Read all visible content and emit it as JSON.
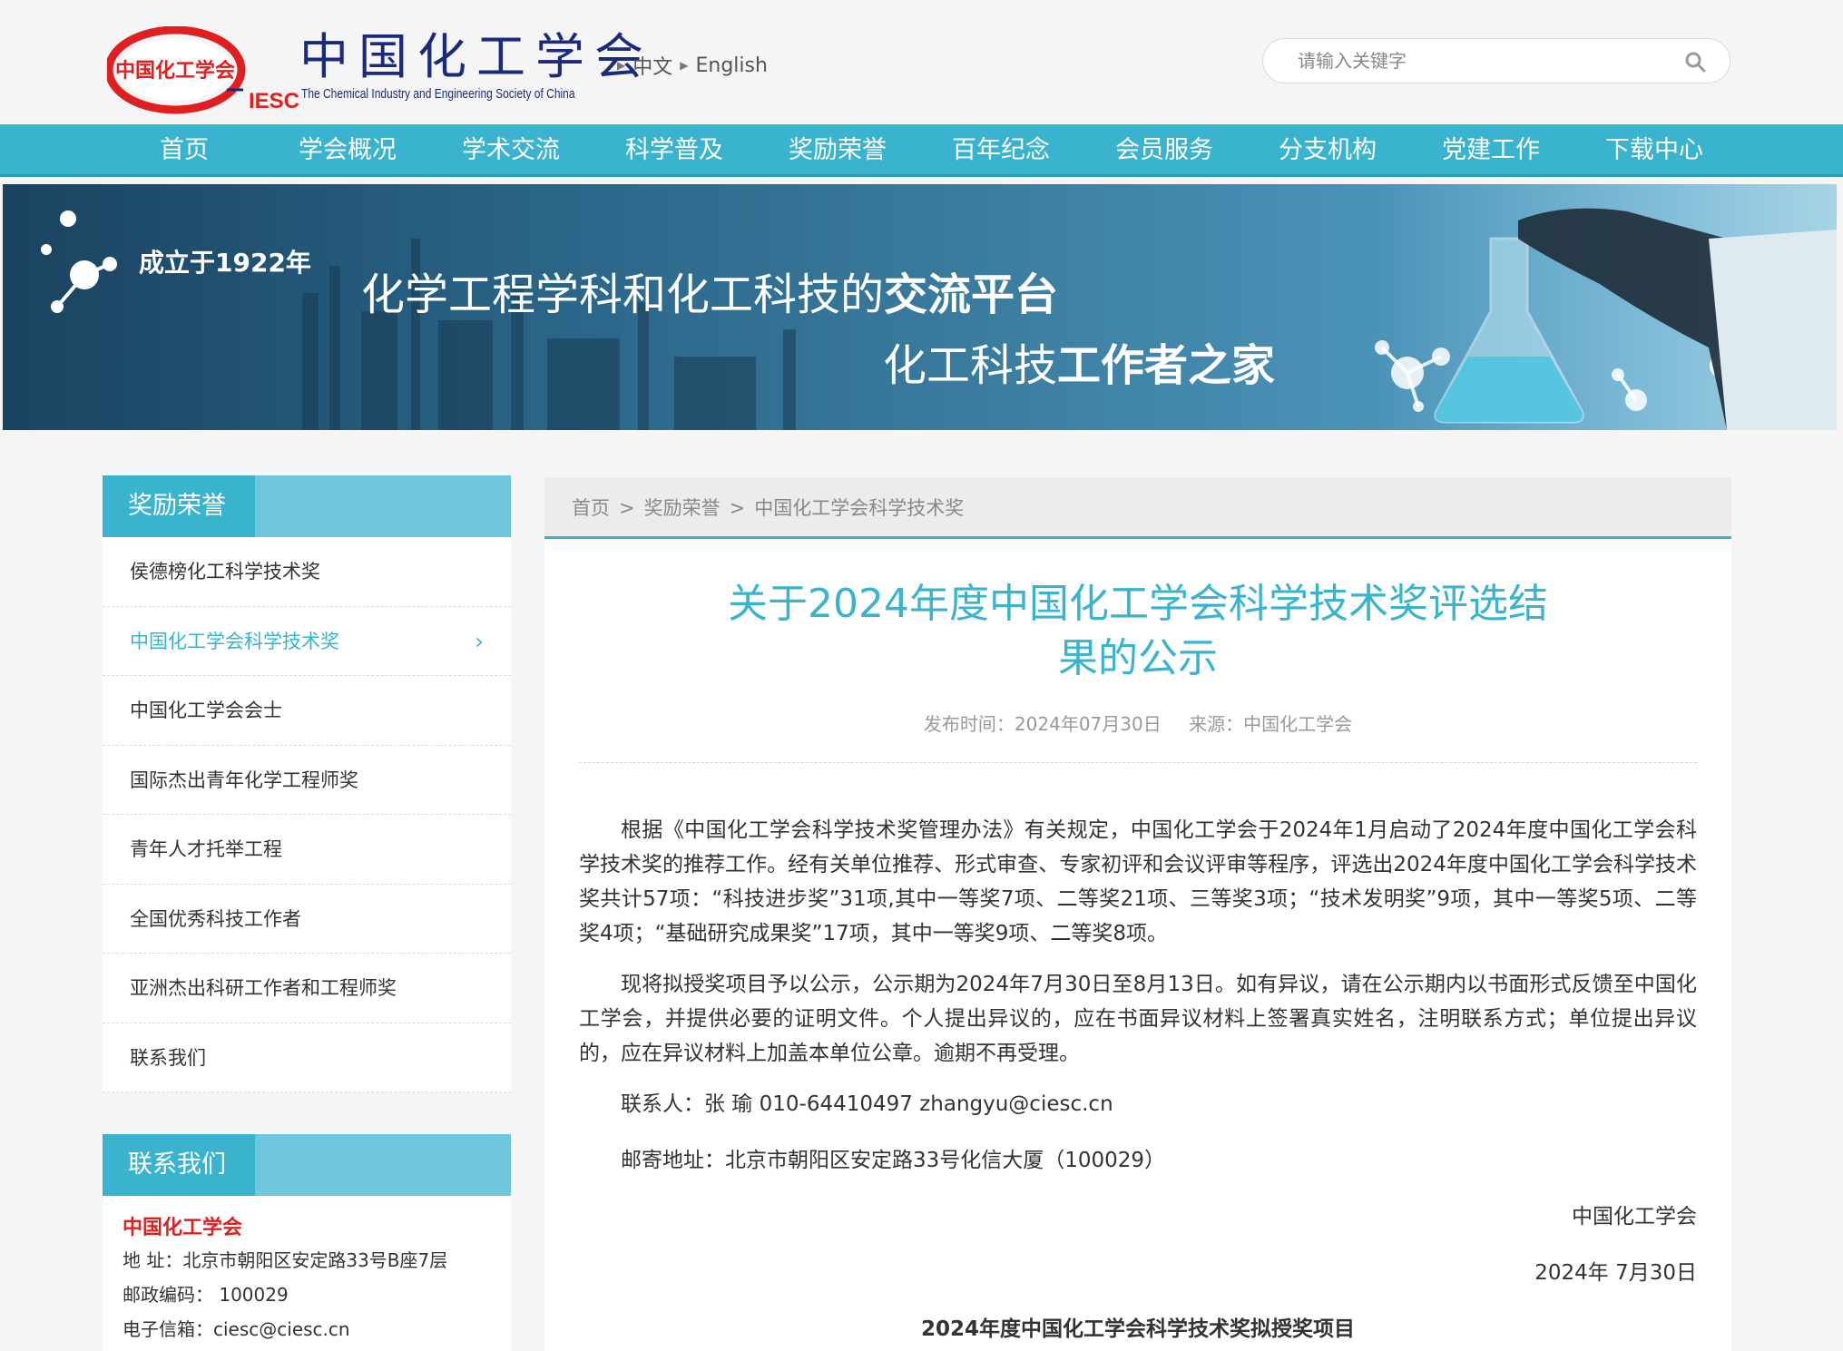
{
  "header": {
    "logo_badge": "中国化工学会",
    "logo_badge_suffix": "IESC",
    "logo_cn": "中国化工学会",
    "logo_en": "The Chemical Industry and Engineering Society of China",
    "lang_cn": "中文",
    "lang_en": "English",
    "search_placeholder": "请输入关键字"
  },
  "nav": [
    "首页",
    "学会概况",
    "学术交流",
    "科学普及",
    "奖励荣誉",
    "百年纪念",
    "会员服务",
    "分支机构",
    "党建工作",
    "下载中心"
  ],
  "banner": {
    "founded": "成立于1922年",
    "line1_normal": "化学工程学科和化工科技的",
    "line1_bold": "交流平台",
    "line2_normal": "化工科技",
    "line2_bold": "工作者之家"
  },
  "sidebar": {
    "title": "奖励荣誉",
    "items": [
      "侯德榜化工科学技术奖",
      "中国化工学会科学技术奖",
      "中国化工学会会士",
      "国际杰出青年化学工程师奖",
      "青年人才托举工程",
      "全国优秀科技工作者",
      "亚洲杰出科研工作者和工程师奖",
      "联系我们"
    ],
    "active_chevron": "›",
    "contact_title": "联系我们",
    "contact": {
      "org": "中国化工学会",
      "address": "地 址：北京市朝阳区安定路33号B座7层",
      "postcode": "邮政编码： 100029",
      "email": "电子信箱：ciesc@ciesc.cn"
    }
  },
  "breadcrumb": {
    "home": "首页",
    "sep": ">",
    "level1": "奖励荣誉",
    "level2": "中国化工学会科学技术奖"
  },
  "article": {
    "title_line1": "关于2024年度中国化工学会科学技术奖评选结",
    "title_line2": "果的公示",
    "publish_time": "发布时间：2024年07月30日",
    "source": "来源：中国化工学会",
    "para1": "根据《中国化工学会科学技术奖管理办法》有关规定，中国化工学会于2024年1月启动了2024年度中国化工学会科学技术奖的推荐工作。经有关单位推荐、形式审查、专家初评和会议评审等程序，评选出2024年度中国化工学会科学技术奖共计57项：“科技进步奖”31项,其中一等奖7项、二等奖21项、三等奖3项；“技术发明奖”9项，其中一等奖5项、二等奖4项；“基础研究成果奖”17项，其中一等奖9项、二等奖8项。",
    "para2": "现将拟授奖项目予以公示，公示期为2024年7月30日至8月13日。如有异议，请在公示期内以书面形式反馈至中国化工学会，并提供必要的证明文件。个人提出异议的，应在书面异议材料上签署真实姓名，注明联系方式；单位提出异议的，应在异议材料上加盖本单位公章。逾期不再受理。",
    "contact_person": "联系人：张  瑜    010-64410497  zhangyu@ciesc.cn",
    "mail_address": "邮寄地址：北京市朝阳区安定路33号化信大厦（100029）",
    "signature": "中国化工学会",
    "date": "2024年 7月30日",
    "table_title": "2024年度中国化工学会科学技术奖拟授奖项目"
  },
  "colors": {
    "accent": "#3ab3ce",
    "logo_red": "#e02020",
    "logo_navy": "#1b2a7a"
  }
}
